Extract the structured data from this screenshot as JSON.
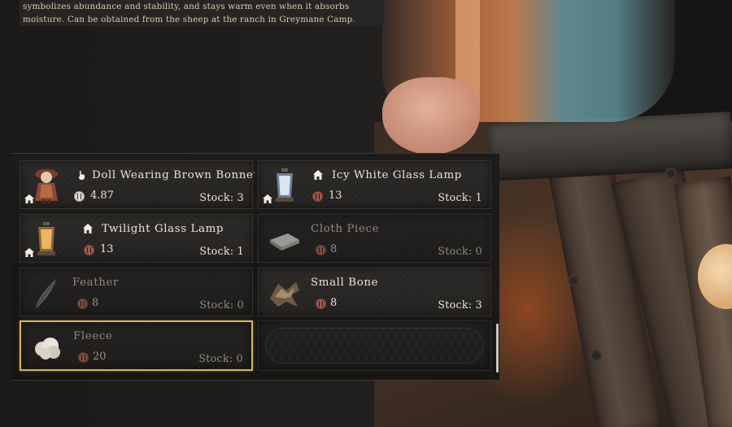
{
  "description": {
    "line1": "symbolizes abundance and stability, and stays warm even when it absorbs",
    "line2": "moisture. Can be obtained from the sheep at the ranch in Greymane Camp."
  },
  "colors": {
    "selected_border": "#d9b565",
    "text_primary": "#ece4d4",
    "text_dim": "#8f877d"
  },
  "items": [
    {
      "name": "Doll Wearing Brown Bonnet",
      "name_icon": "hand-icon",
      "price": "4.87",
      "currency": "silver-coin",
      "stock_label": "Stock: 3",
      "home_badge": true,
      "available": true,
      "selected": false,
      "thumb": "doll-icon"
    },
    {
      "name": "Icy White Glass Lamp",
      "name_icon": "house-icon",
      "price": "13",
      "currency": "copper-coin",
      "stock_label": "Stock: 1",
      "home_badge": true,
      "available": true,
      "selected": false,
      "thumb": "icy-lamp-icon"
    },
    {
      "name": "Twilight Glass Lamp",
      "name_icon": "house-icon",
      "price": "13",
      "currency": "copper-coin",
      "stock_label": "Stock: 1",
      "home_badge": true,
      "available": true,
      "selected": false,
      "thumb": "twilight-lamp-icon"
    },
    {
      "name": "Cloth Piece",
      "price": "8",
      "currency": "copper-coin",
      "stock_label": "Stock: 0",
      "home_badge": false,
      "available": false,
      "selected": false,
      "thumb": "cloth-icon"
    },
    {
      "name": "Feather",
      "price": "8",
      "currency": "copper-coin",
      "stock_label": "Stock: 0",
      "home_badge": false,
      "available": false,
      "selected": false,
      "thumb": "feather-icon"
    },
    {
      "name": "Small Bone",
      "price": "8",
      "currency": "copper-coin",
      "stock_label": "Stock: 3",
      "home_badge": false,
      "available": true,
      "selected": false,
      "thumb": "bone-icon"
    },
    {
      "name": "Fleece",
      "price": "20",
      "currency": "copper-coin",
      "stock_label": "Stock: 0",
      "home_badge": false,
      "available": false,
      "selected": true,
      "thumb": "fleece-icon"
    }
  ]
}
